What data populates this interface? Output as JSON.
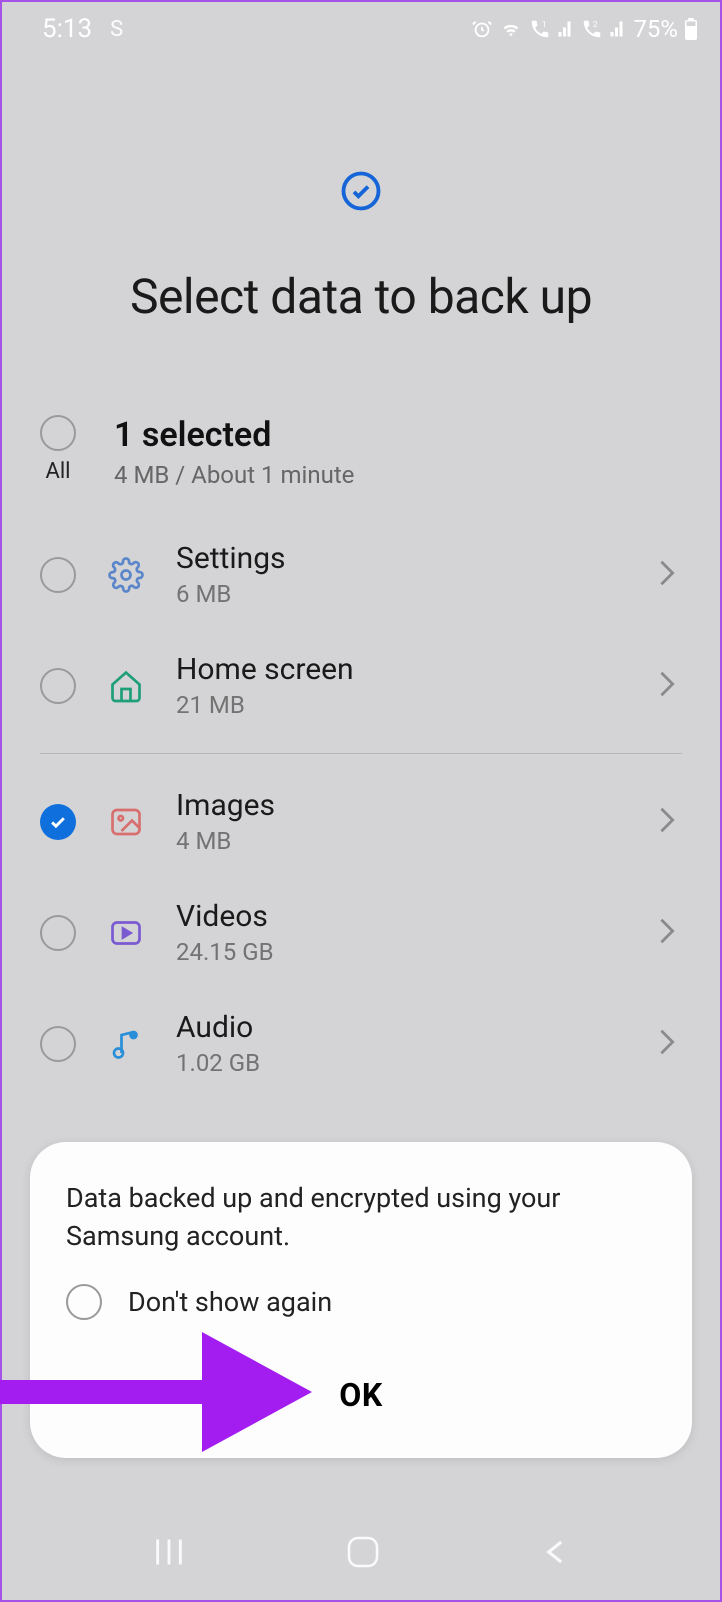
{
  "status": {
    "time": "5:13",
    "carrier_indicator": "S",
    "battery_pct": "75%"
  },
  "header": {
    "title": "Select data to back up"
  },
  "summary": {
    "all_label": "All",
    "selected_count": "1 selected",
    "detail": "4 MB / About 1 minute"
  },
  "items": [
    {
      "name": "Settings",
      "size": "6 MB",
      "checked": false,
      "icon": "gear",
      "color": "#5b86c9"
    },
    {
      "name": "Home screen",
      "size": "21 MB",
      "checked": false,
      "icon": "home",
      "color": "#1f9e7a"
    },
    {
      "name": "Images",
      "size": "4 MB",
      "checked": true,
      "icon": "image",
      "color": "#d86f6f"
    },
    {
      "name": "Videos",
      "size": "24.15 GB",
      "checked": false,
      "icon": "video",
      "color": "#7a5ad0"
    },
    {
      "name": "Audio",
      "size": "1.02 GB",
      "checked": false,
      "icon": "audio",
      "color": "#2a8fd9"
    }
  ],
  "toast": {
    "message": "Data backed up and encrypted using your Samsung account.",
    "dont_show_label": "Don't show again",
    "ok_label": "OK"
  }
}
